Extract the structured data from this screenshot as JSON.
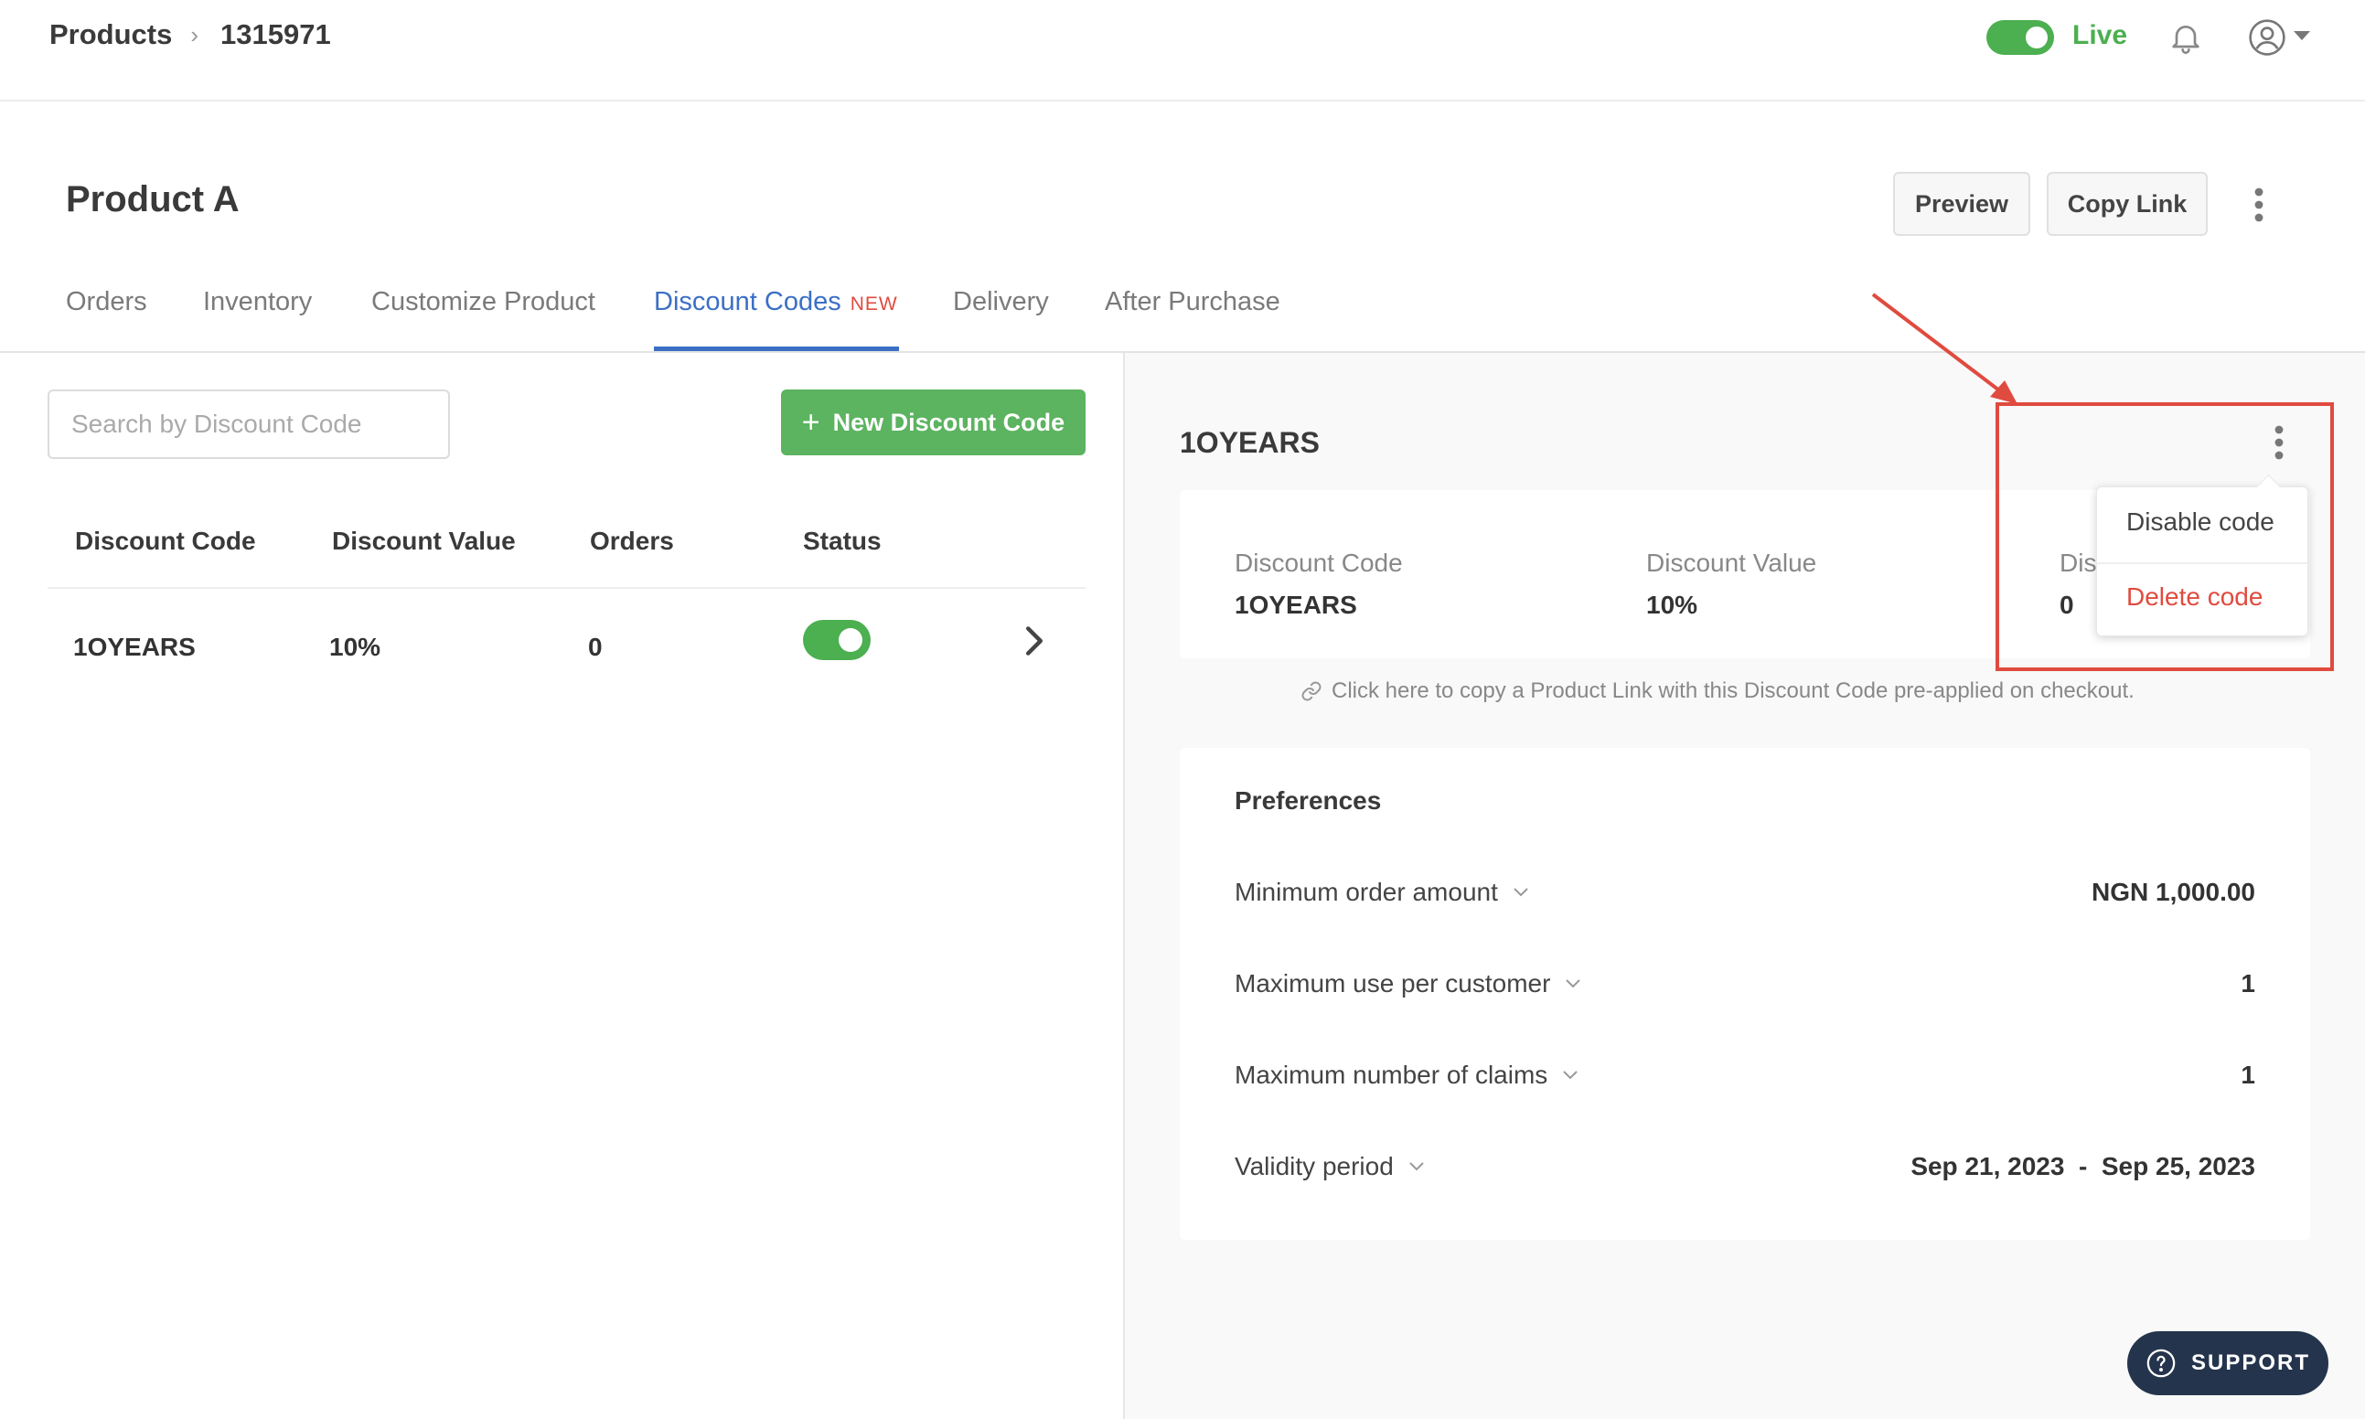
{
  "breadcrumb": {
    "root": "Products",
    "current": "1315971"
  },
  "topbar": {
    "live_label": "Live"
  },
  "product": {
    "title": "Product A"
  },
  "actions": {
    "preview": "Preview",
    "copy_link": "Copy Link"
  },
  "tabs": [
    {
      "label": "Orders"
    },
    {
      "label": "Inventory"
    },
    {
      "label": "Customize Product"
    },
    {
      "label": "Discount Codes",
      "badge": "NEW",
      "active": true
    },
    {
      "label": "Delivery"
    },
    {
      "label": "After Purchase"
    }
  ],
  "list": {
    "search_placeholder": "Search by Discount Code",
    "new_button": "New Discount Code",
    "columns": [
      "Discount Code",
      "Discount Value",
      "Orders",
      "Status"
    ],
    "rows": [
      {
        "code": "1OYEARS",
        "value": "10%",
        "orders": "0",
        "status_on": true
      }
    ]
  },
  "detail": {
    "heading": "1OYEARS",
    "fields": [
      {
        "label": "Discount Code",
        "value": "1OYEARS"
      },
      {
        "label": "Discount Value",
        "value": "10%"
      },
      {
        "label": "Dis",
        "value": "0"
      }
    ],
    "copy_link_text": "Click here to copy a Product Link with this Discount Code pre-applied on checkout.",
    "preferences_title": "Preferences",
    "preferences": [
      {
        "label": "Minimum order amount",
        "value": "NGN 1,000.00"
      },
      {
        "label": "Maximum use per customer",
        "value": "1"
      },
      {
        "label": "Maximum number of claims",
        "value": "1"
      },
      {
        "label": "Validity period",
        "value": "Sep 21, 2023  -  Sep 25, 2023"
      }
    ]
  },
  "menu": {
    "disable": "Disable code",
    "delete": "Delete code"
  },
  "support": {
    "label": "SUPPORT"
  },
  "colors": {
    "accent": "#3b6fc6",
    "success": "#4caf50",
    "danger": "#e04b3f",
    "support_bg": "#24344c"
  }
}
